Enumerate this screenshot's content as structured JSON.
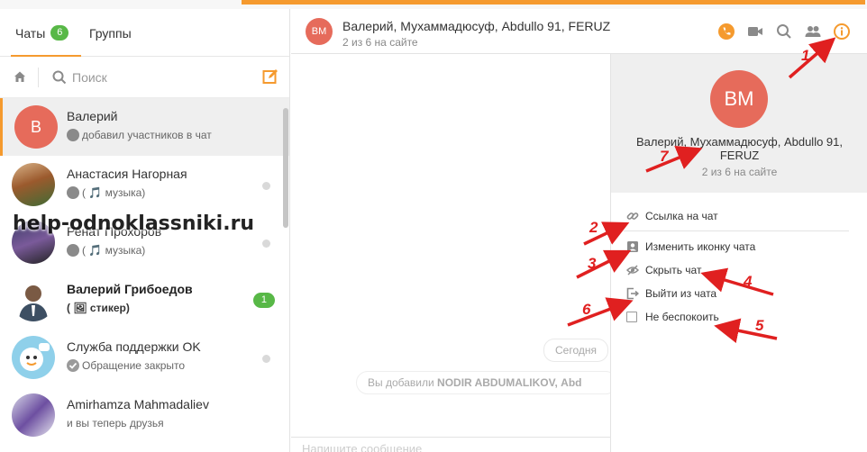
{
  "tabs": {
    "chats_label": "Чаты",
    "chats_count": "6",
    "groups_label": "Группы"
  },
  "search": {
    "placeholder": "Поиск"
  },
  "chats": [
    {
      "name": "Валерий",
      "initial": "В",
      "preview": "добавил участников в чат",
      "avatar_color": "#e66b5b"
    },
    {
      "name": "Анастасия Нагорная",
      "preview": "( 🎵 музыка)"
    },
    {
      "name": "Ренат Прохоров",
      "preview": "( 🎵 музыка)"
    },
    {
      "name": "Валерий Грибоедов",
      "preview": "( 🖼 стикер)",
      "unread": "1"
    },
    {
      "name": "Служба поддержки OK",
      "preview": "Обращение закрыто"
    },
    {
      "name": "Amirhamza Mahmadaliev",
      "preview": "и вы теперь друзья"
    }
  ],
  "header": {
    "avatar_initials": "BM",
    "title": "Валерий, Мухаммадюсуф, Abdullo 91, FERUZ",
    "subtitle": "2 из 6 на сайте"
  },
  "chat_body": {
    "today_label": "Сегодня",
    "system_message_prefix": "Вы добавили",
    "system_message_user1": "NODIR ABDUMALIKOV,",
    "system_message_user2": "Abd",
    "compose_placeholder": "Напишите сообщение"
  },
  "info": {
    "avatar_initials": "BM",
    "title": "Валерий, Мухаммадюсуф, Abdullo 91, FERUZ",
    "subtitle": "2 из 6 на сайте",
    "menu": {
      "link": "Ссылка на чат",
      "change_icon": "Изменить иконку чата",
      "hide": "Скрыть чат",
      "leave": "Выйти из чата",
      "dnd": "Не беспокоить"
    }
  },
  "watermark": "help-odnoklassniki.ru",
  "annotations": [
    "1",
    "2",
    "3",
    "4",
    "5",
    "6",
    "7"
  ],
  "colors": {
    "accent": "#f59a2e",
    "badge_green": "#58b847",
    "avatar_red": "#e66b5b",
    "arrow_red": "#e02020"
  }
}
